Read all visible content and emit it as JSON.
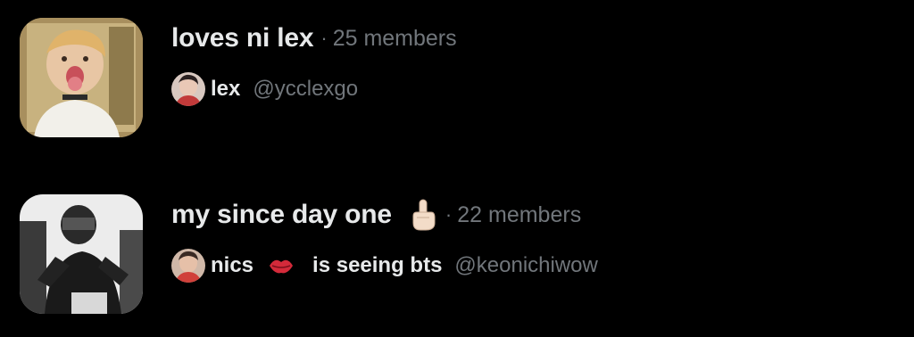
{
  "lists": [
    {
      "name": "loves ni lex",
      "separator": "·",
      "member_count": "25 members",
      "owner": {
        "name": "lex",
        "handle": "@ycclexgo"
      },
      "thumbnail_icon": "photo-thumbnail-icon"
    },
    {
      "name": "my since day one",
      "emoji": "pointing-up-icon",
      "separator": "·",
      "member_count": "22 members",
      "owner": {
        "name_prefix": "nics",
        "name_emoji": "lips-icon",
        "name_suffix": "is seeing bts",
        "handle": "@keonichiwow"
      },
      "thumbnail_icon": "photo-thumbnail-icon"
    }
  ],
  "colors": {
    "background": "#000000",
    "primary_text": "#e7e9ea",
    "secondary_text": "#71767b"
  }
}
